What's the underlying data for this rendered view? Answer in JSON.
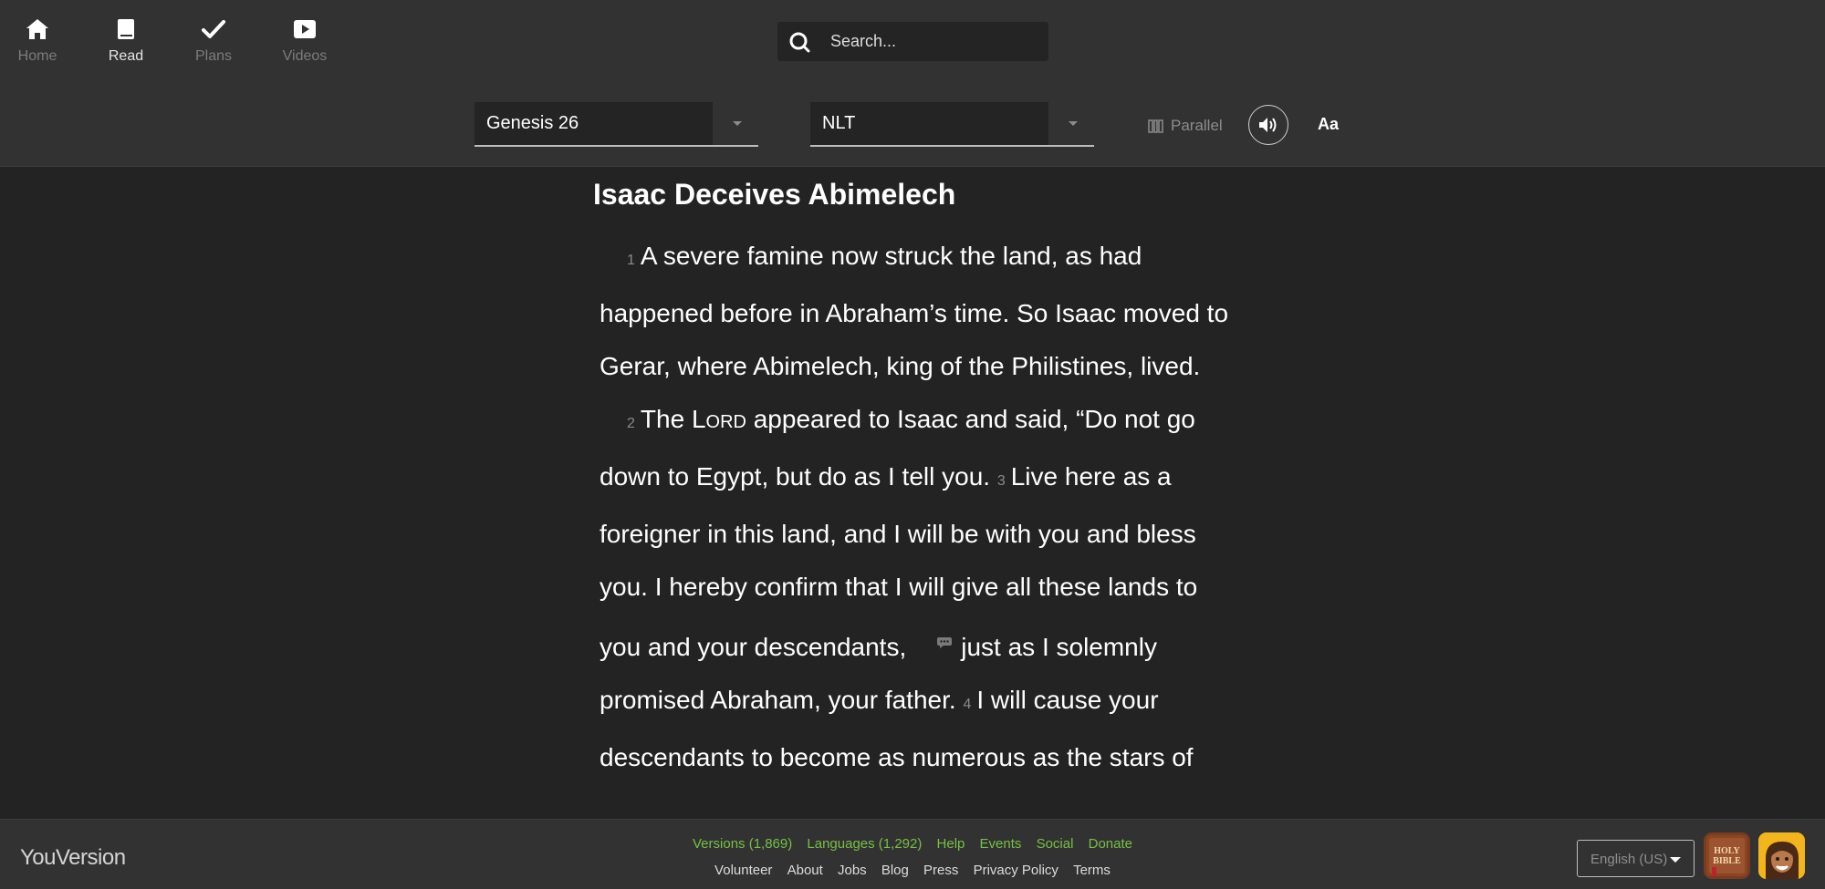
{
  "nav": {
    "items": [
      {
        "label": "Home",
        "icon": "home-icon"
      },
      {
        "label": "Read",
        "icon": "book-icon"
      },
      {
        "label": "Plans",
        "icon": "check-icon"
      },
      {
        "label": "Videos",
        "icon": "play-icon"
      }
    ],
    "active": "Read"
  },
  "search": {
    "placeholder": "Search..."
  },
  "toolbar": {
    "book_chapter": "Genesis 26",
    "version": "NLT",
    "parallel_label": "Parallel",
    "font_label": "Aa"
  },
  "reader": {
    "heading": "Isaac Deceives Abimelech",
    "v1_num": "1",
    "v1_text": "A severe famine now struck the land, as had happened before in Abraham’s time. So Isaac moved to Gerar, where Abimelech, king of the Philistines, lived.",
    "v2_num": "2",
    "v2_a": "The ",
    "v2_lord": "Lord",
    "v2_b": " appeared to Isaac and said, “Do not go down to Egypt, but do as I tell you.",
    "v3_num": "3",
    "v3_a": "Live here as a foreigner in this land, and I will be with you and bless you. I hereby confirm that I will give all these lands to you and your descendants,",
    "v3_b": "just as I solemnly promised Abraham, your father.",
    "v4_num": "4",
    "v4_text": "I will cause your descendants to become as numerous as the stars of"
  },
  "footer": {
    "brand": "YouVersion",
    "links_top": [
      "Versions (1,869)",
      "Languages (1,292)",
      "Help",
      "Events",
      "Social",
      "Donate"
    ],
    "links_bottom": [
      "Volunteer",
      "About",
      "Jobs",
      "Blog",
      "Press",
      "Privacy Policy",
      "Terms"
    ],
    "language": "English (US)",
    "bible_app_icon_text": "HOLY BIBLE"
  },
  "colors": {
    "background": "#232323",
    "header": "#323232",
    "link_green": "#76c043"
  }
}
